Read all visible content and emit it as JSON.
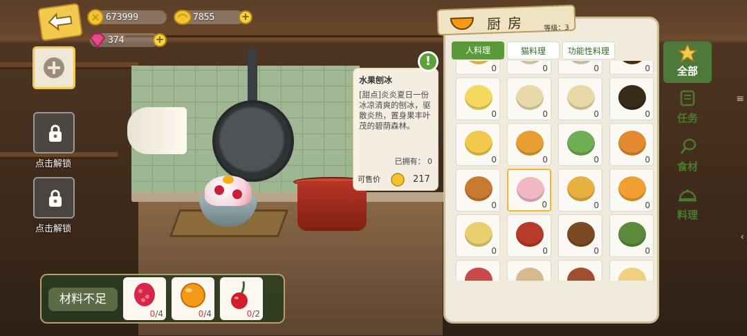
{
  "resources": {
    "coins": "673999",
    "gold": "7855",
    "gems": "374"
  },
  "left_slots": {
    "unlock_label_1": "点击解锁",
    "unlock_label_2": "点击解锁"
  },
  "ingredients": {
    "title": "材料不足",
    "items": [
      {
        "icon": "raspberry-icon",
        "have": "0",
        "need": "/4"
      },
      {
        "icon": "orange-icon",
        "have": "0",
        "need": "/4"
      },
      {
        "icon": "cherry-icon",
        "have": "0",
        "need": "/2"
      }
    ]
  },
  "tooltip": {
    "name": "水果刨冰",
    "desc": "[甜点]炎炎夏日一份冰凉清爽的刨冰，驱散炎热，置身果丰叶茂的碧荫森林。",
    "owned_label": "已拥有：",
    "owned": "0",
    "price_label": "可售价",
    "price": "217",
    "alert": "!"
  },
  "panel": {
    "title": "厨房",
    "level": "等级：3",
    "tabs": [
      "人料理",
      "猫料理",
      "功能性料理"
    ],
    "side": [
      "全部",
      "任务",
      "食材",
      "料理"
    ]
  },
  "grid_counts": [
    "0",
    "0",
    "0",
    "0",
    "0",
    "0",
    "0",
    "0",
    "0",
    "0",
    "0",
    "0",
    "0",
    "0",
    "0",
    "0",
    "0",
    "0",
    "0",
    "0",
    "0",
    "0",
    "0",
    "0"
  ],
  "grid_icons": [
    "whisk-icon",
    "flour-icon",
    "plate-icon",
    "plate-icon",
    "butter-icon",
    "sack-icon",
    "sack-icon",
    "sauce-bottle-icon",
    "omelette-icon",
    "fries-icon",
    "green-rolls-icon",
    "pasta-icon",
    "grilled-fish-icon",
    "shaved-ice-icon",
    "fries-plate-icon",
    "croquette-icon",
    "tofu-icon",
    "stew-icon",
    "brownie-icon",
    "salad-icon",
    "dish-icon",
    "dish-icon",
    "dish-icon",
    "dish-icon"
  ],
  "colors": {
    "accent_green": "#5a9a3a",
    "gold": "#f2c94c",
    "warn_red": "#d83a3a"
  }
}
